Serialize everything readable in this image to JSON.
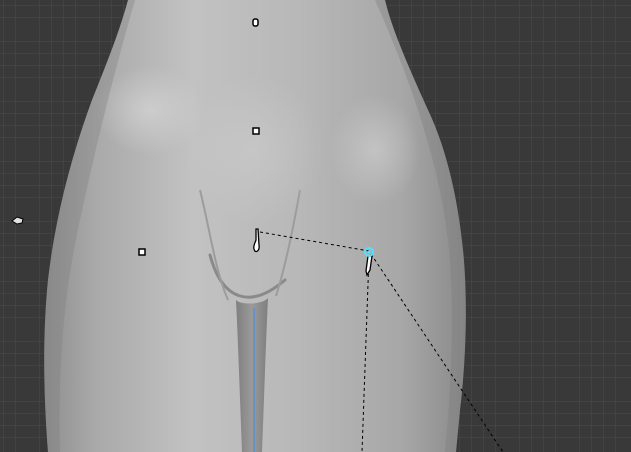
{
  "viewport": {
    "background_color": "#393939",
    "grid_color": "#444444"
  },
  "mesh": {
    "name": "body-mesh",
    "base_color": "#b4b4b4",
    "highlight_color": "#cfcfcf",
    "shadow_color": "#8e8e8e"
  },
  "selection": {
    "active_handle_color": "#4fe3ff",
    "relationship_line_color": "#000000",
    "axis_line_color": "#4a90e2"
  },
  "icons": [
    "navel-empty-icon",
    "pelvis-empty-icon",
    "hip-left-empty-icon",
    "groin-bone-icon",
    "thigh-bone-icon",
    "active-joint-icon",
    "offscreen-arrow-icon"
  ]
}
